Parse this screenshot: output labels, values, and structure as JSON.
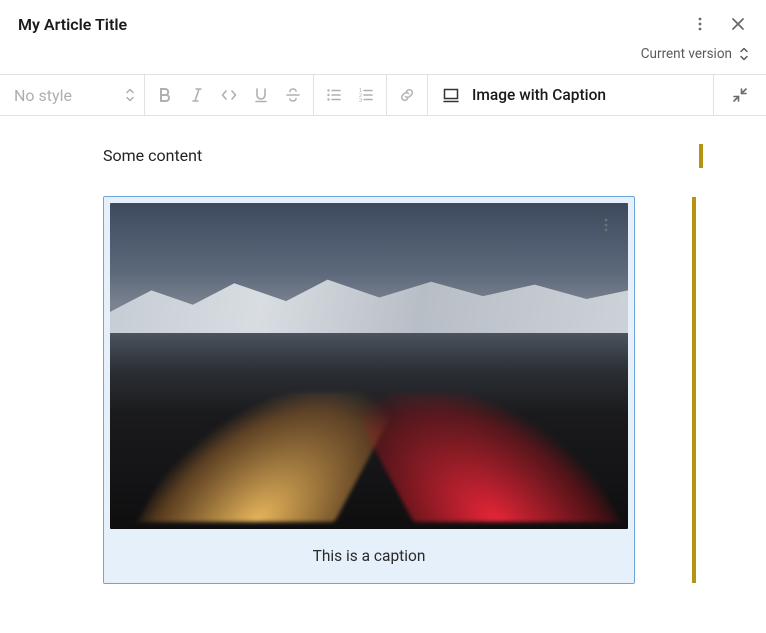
{
  "header": {
    "title": "My Article Title",
    "version_label": "Current version"
  },
  "toolbar": {
    "style_label": "No style",
    "block_type_label": "Image with Caption"
  },
  "content": {
    "text_block": "Some content",
    "caption": "This is a caption"
  }
}
